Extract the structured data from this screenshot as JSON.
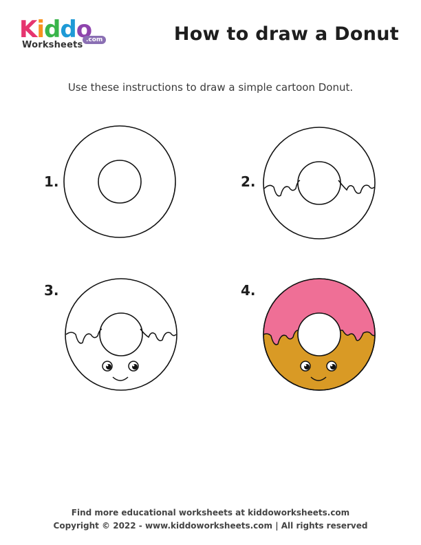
{
  "header": {
    "logo_letters": [
      {
        "char": "K",
        "color": "#e6356f"
      },
      {
        "char": "i",
        "color": "#f7931e"
      },
      {
        "char": "d",
        "color": "#39b54a"
      },
      {
        "char": "d",
        "color": "#1e9ad6"
      },
      {
        "char": "o",
        "color": "#8e44ad"
      }
    ],
    "logo_sub": "Worksheets",
    "logo_com": ".com",
    "title": "How to draw a Donut"
  },
  "instructions": "Use these instructions to draw a simple cartoon Donut.",
  "steps": [
    {
      "number": "1."
    },
    {
      "number": "2."
    },
    {
      "number": "3."
    },
    {
      "number": "4."
    }
  ],
  "colors": {
    "outline": "#111111",
    "icing": "#ef6f96",
    "dough": "#d99a25"
  },
  "footer": {
    "line1": "Find more educational worksheets at kiddoworksheets.com",
    "line2": "Copyright © 2022 - www.kiddoworksheets.com  |  All rights reserved"
  }
}
